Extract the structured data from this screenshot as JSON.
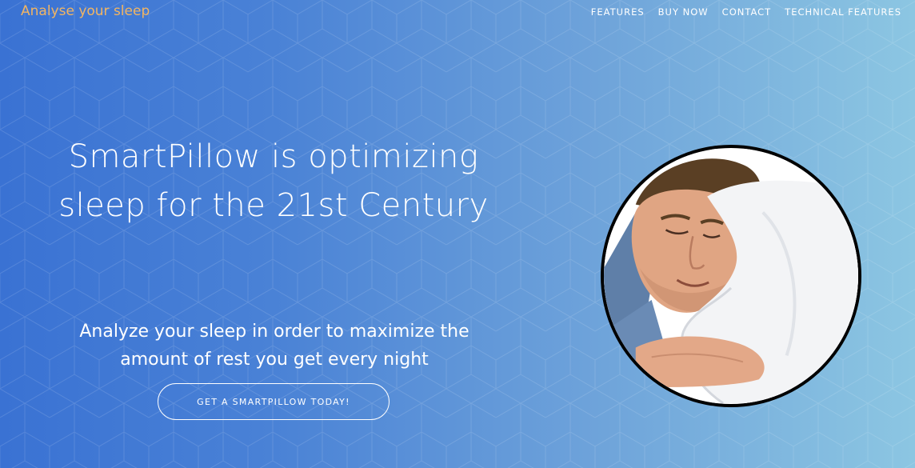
{
  "navbar": {
    "brand": "Analyse your sleep",
    "links": [
      "FEATURES",
      "BUY NOW",
      "CONTACT",
      "TECHNICAL FEATURES"
    ]
  },
  "hero": {
    "headline": "SmartPillow is optimizing sleep for the 21st Century",
    "subheadline": "Analyze your sleep in order to maximize the amount of rest you get every night",
    "cta_label": "GET A SMARTPILLOW TODAY!"
  },
  "colors": {
    "brand": "#f2b562",
    "gradient_start": "#3a72d3",
    "gradient_end": "#8cc6e2"
  }
}
